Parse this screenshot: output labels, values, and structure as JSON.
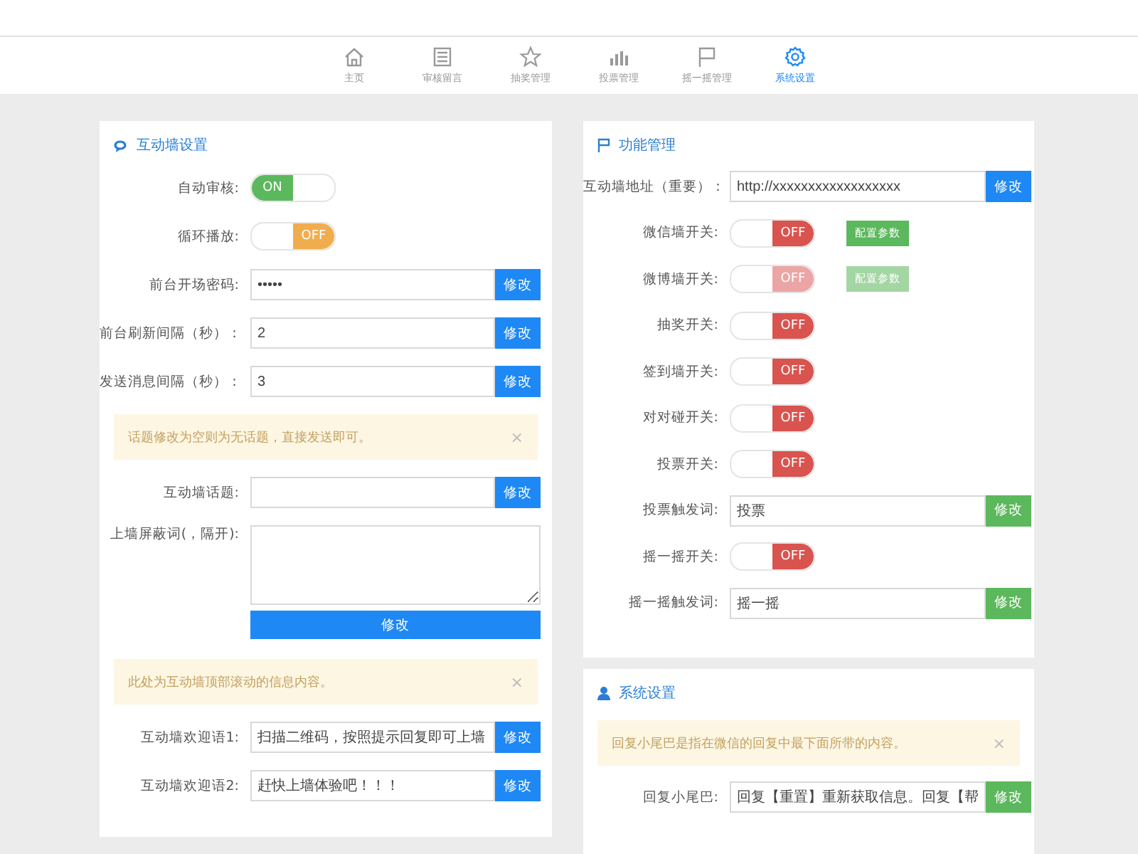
{
  "nav": [
    {
      "label": "主页",
      "selected": false
    },
    {
      "label": "审核留言",
      "selected": false
    },
    {
      "label": "抽奖管理",
      "selected": false
    },
    {
      "label": "投票管理",
      "selected": false
    },
    {
      "label": "摇一摇管理",
      "selected": false
    },
    {
      "label": "系统设置",
      "selected": true
    }
  ],
  "left": {
    "title": "互动墙设置",
    "rows": [
      {
        "kind": "toggle",
        "label": "自动审核:",
        "on": true,
        "text": "ON",
        "color": "#5cb85c"
      },
      {
        "kind": "toggle",
        "label": "循环播放:",
        "on": false,
        "text": "OFF",
        "color": "#f0ad4e"
      },
      {
        "kind": "field",
        "label": "前台开场密码:",
        "value": "•••••",
        "button": "修改",
        "color": "#1e88f5"
      },
      {
        "kind": "field",
        "label": "前台刷新间隔（秒）：",
        "value": "2",
        "button": "修改",
        "color": "#1e88f5"
      },
      {
        "kind": "field",
        "label": "发送消息间隔（秒）：",
        "value": "3",
        "button": "修改",
        "color": "#1e88f5"
      },
      {
        "kind": "alert",
        "text": "话题修改为空则为无话题，直接发送即可。",
        "close": "×"
      },
      {
        "kind": "field",
        "label": "互动墙话题:",
        "value": "",
        "button": "修改",
        "color": "#1e88f5"
      },
      {
        "kind": "textarea",
        "label": "上墙屏蔽词(，隔开):",
        "button": "修改",
        "color": "#1e88f5"
      },
      {
        "kind": "alert",
        "text": "此处为互动墙顶部滚动的信息内容。",
        "close": "×"
      },
      {
        "kind": "field",
        "label": "互动墙欢迎语1:",
        "value": "扫描二维码，按照提示回复即可上墙",
        "button": "修改",
        "color": "#1e88f5"
      },
      {
        "kind": "field",
        "label": "互动墙欢迎语2:",
        "value": "赶快上墙体验吧！！！",
        "button": "修改",
        "color": "#1e88f5"
      }
    ]
  },
  "right": {
    "title": "功能管理",
    "rows": [
      {
        "kind": "field",
        "label": "互动墙地址（重要）：",
        "value": "http://xxxxxxxxxxxxxxxxxx",
        "button": "修改",
        "color": "#1e88f5"
      },
      {
        "kind": "toggle",
        "label": "微信墙开关:",
        "on": false,
        "text": "OFF",
        "color": "#d9534f",
        "config": "配置参数",
        "disabled": false
      },
      {
        "kind": "toggle",
        "label": "微博墙开关:",
        "on": false,
        "text": "OFF",
        "color": "#eba5a5",
        "config": "配置参数",
        "disabled": true
      },
      {
        "kind": "toggle",
        "label": "抽奖开关:",
        "on": false,
        "text": "OFF",
        "color": "#d9534f"
      },
      {
        "kind": "toggle",
        "label": "签到墙开关:",
        "on": false,
        "text": "OFF",
        "color": "#d9534f"
      },
      {
        "kind": "toggle",
        "label": "对对碰开关:",
        "on": false,
        "text": "OFF",
        "color": "#d9534f"
      },
      {
        "kind": "toggle",
        "label": "投票开关:",
        "on": false,
        "text": "OFF",
        "color": "#d9534f"
      },
      {
        "kind": "field",
        "label": "投票触发词:",
        "value": "投票",
        "button": "修改",
        "color": "#5cb85c"
      },
      {
        "kind": "toggle",
        "label": "摇一摇开关:",
        "on": false,
        "text": "OFF",
        "color": "#d9534f"
      },
      {
        "kind": "field",
        "label": "摇一摇触发词:",
        "value": "摇一摇",
        "button": "修改",
        "color": "#5cb85c"
      }
    ]
  },
  "system": {
    "title": "系统设置",
    "rows": [
      {
        "kind": "alert",
        "text": "回复小尾巴是指在微信的回复中最下面所带的内容。",
        "close": "×"
      },
      {
        "kind": "field",
        "label": "回复小尾巴:",
        "value": "回复【重置】重新获取信息。回复【帮",
        "button": "修改",
        "color": "#5cb85c"
      }
    ]
  }
}
